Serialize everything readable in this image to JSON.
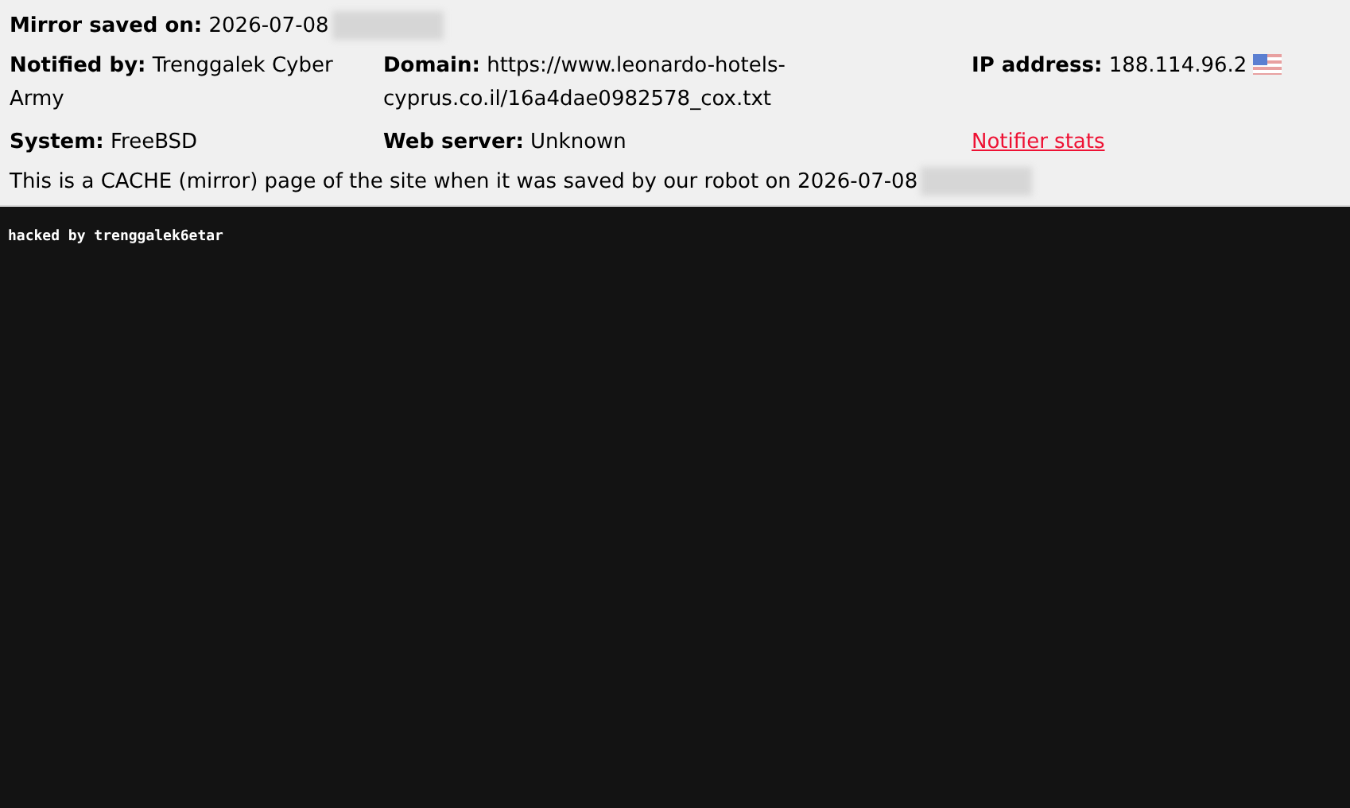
{
  "mirror_saved_on": {
    "label": "Mirror saved on:",
    "value": "2026-07-08"
  },
  "fields": [
    {
      "label": "Notified by:",
      "value": "Trenggalek Cyber Army"
    },
    {
      "label": "Domain:",
      "value": "https://www.leonardo-hotels-cyprus.co.il/16a4dae0982578_cox.txt"
    },
    {
      "label": "IP address:",
      "value": "188.114.96.2"
    },
    {
      "label": "System:",
      "value": "FreeBSD"
    },
    {
      "label": "Web server:",
      "value": "Unknown"
    },
    {
      "kind": "link",
      "value": "Notifier stats"
    }
  ],
  "notice": "This is a CACHE (mirror) page of the site when it was saved by our robot on 2026-07-08",
  "mirror_content": {
    "text": "hacked by trenggalek6etar"
  }
}
